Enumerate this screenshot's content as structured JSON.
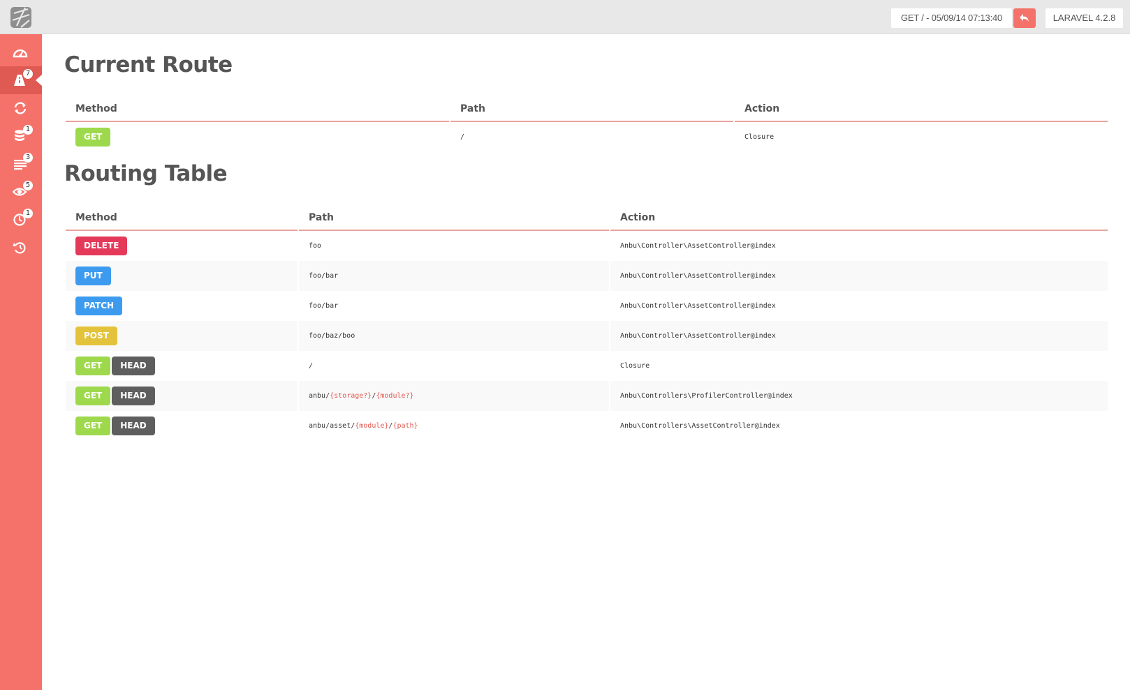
{
  "header": {
    "request_info": "GET / - 05/09/14 07:13:40",
    "version": "LARAVEL 4.2.8"
  },
  "sidebar": {
    "items": [
      {
        "icon": "dashboard-icon",
        "badge": null,
        "active": false
      },
      {
        "icon": "road-icon",
        "badge": "7",
        "active": true
      },
      {
        "icon": "refresh-icon",
        "badge": null,
        "active": false
      },
      {
        "icon": "database-icon",
        "badge": "1",
        "active": false
      },
      {
        "icon": "list-icon",
        "badge": "3",
        "active": false
      },
      {
        "icon": "eye-icon",
        "badge": "5",
        "active": false
      },
      {
        "icon": "clock-icon",
        "badge": "1",
        "active": false
      },
      {
        "icon": "history-icon",
        "badge": null,
        "active": false
      }
    ]
  },
  "current_route": {
    "title": "Current Route",
    "columns": [
      "Method",
      "Path",
      "Action"
    ],
    "row": {
      "methods": [
        "GET"
      ],
      "path": "/",
      "action": "Closure"
    }
  },
  "routing_table": {
    "title": "Routing Table",
    "columns": [
      "Method",
      "Path",
      "Action"
    ],
    "rows": [
      {
        "methods": [
          "DELETE"
        ],
        "path": [
          {
            "t": "foo"
          }
        ],
        "action": "Anbu\\Controller\\AssetController@index"
      },
      {
        "methods": [
          "PUT"
        ],
        "path": [
          {
            "t": "foo/bar"
          }
        ],
        "action": "Anbu\\Controller\\AssetController@index"
      },
      {
        "methods": [
          "PATCH"
        ],
        "path": [
          {
            "t": "foo/bar"
          }
        ],
        "action": "Anbu\\Controller\\AssetController@index"
      },
      {
        "methods": [
          "POST"
        ],
        "path": [
          {
            "t": "foo/baz/boo"
          }
        ],
        "action": "Anbu\\Controller\\AssetController@index"
      },
      {
        "methods": [
          "GET",
          "HEAD"
        ],
        "path": [
          {
            "t": "/"
          }
        ],
        "action": "Closure"
      },
      {
        "methods": [
          "GET",
          "HEAD"
        ],
        "path": [
          {
            "t": "anbu/"
          },
          {
            "p": "{storage?}"
          },
          {
            "t": "/"
          },
          {
            "p": "{module?}"
          }
        ],
        "action": "Anbu\\Controllers\\ProfilerController@index"
      },
      {
        "methods": [
          "GET",
          "HEAD"
        ],
        "path": [
          {
            "t": "anbu/asset/"
          },
          {
            "p": "{module}"
          },
          {
            "t": "/"
          },
          {
            "p": "{path}"
          }
        ],
        "action": "Anbu\\Controllers\\AssetController@index"
      }
    ]
  },
  "colors": {
    "accent": "#f4726a",
    "accent_dark": "#de5a53",
    "GET": "#9ed84d",
    "HEAD": "#5e5e5e",
    "DELETE": "#e5395a",
    "PUT": "#3d9bef",
    "PATCH": "#3d9bef",
    "POST": "#e3c33b"
  }
}
